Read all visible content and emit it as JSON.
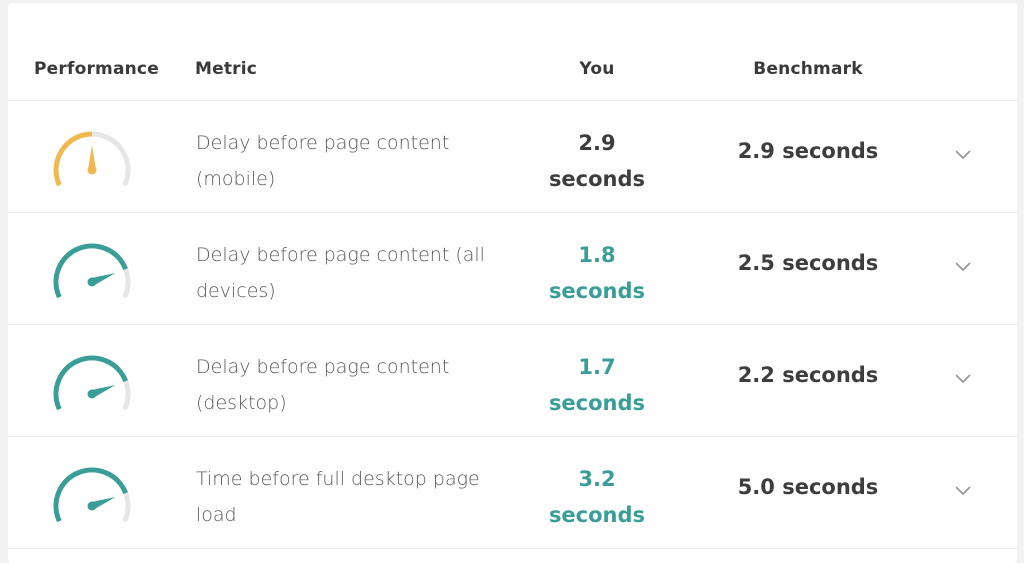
{
  "table": {
    "headers": {
      "performance": "Performance",
      "metric": "Metric",
      "you": "You",
      "benchmark": "Benchmark"
    },
    "rows": [
      {
        "metric": "Delay before page content (mobile)",
        "you_value": "2.9",
        "you_unit": "seconds",
        "benchmark": "2.9 seconds",
        "status": "warning",
        "gauge_color": "#f0b84f",
        "gauge_level": 0.5
      },
      {
        "metric": "Delay before page content (all devices)",
        "you_value": "1.8",
        "you_unit": "seconds",
        "benchmark": "2.5 seconds",
        "status": "good",
        "gauge_color": "#3a9e98",
        "gauge_level": 0.8
      },
      {
        "metric": "Delay before page content (desktop)",
        "you_value": "1.7",
        "you_unit": "seconds",
        "benchmark": "2.2 seconds",
        "status": "good",
        "gauge_color": "#3a9e98",
        "gauge_level": 0.8
      },
      {
        "metric": "Time before full desktop page load",
        "you_value": "3.2",
        "you_unit": "seconds",
        "benchmark": "5.0 seconds",
        "status": "good",
        "gauge_color": "#3a9e98",
        "gauge_level": 0.8
      }
    ]
  },
  "colors": {
    "gauge_track": "#e6e6e6",
    "good_text": "#3a9e98",
    "chevron": "#9a9a9a"
  }
}
